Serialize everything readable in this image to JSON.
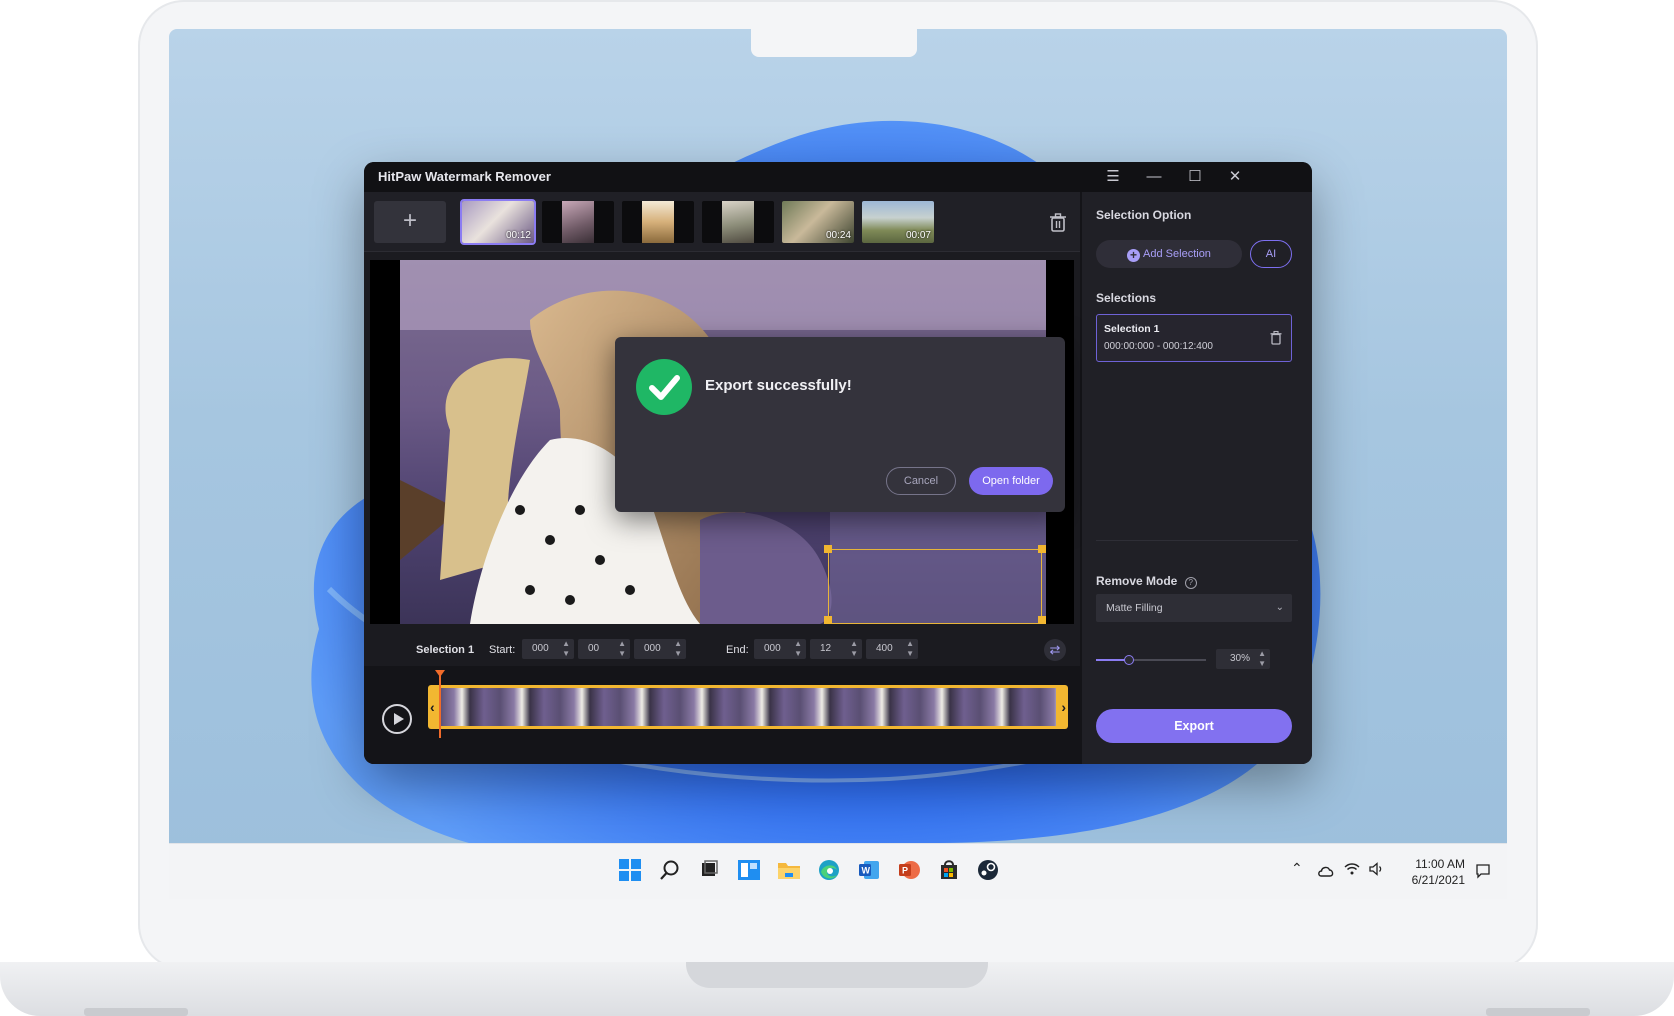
{
  "app": {
    "title": "HitPaw Watermark Remover"
  },
  "window_controls": {
    "menu_icon": "menu-icon",
    "minimize_icon": "minimize-icon",
    "maximize_icon": "maximize-icon",
    "close_icon": "close-icon"
  },
  "media_strip": {
    "add_label": "+",
    "thumbnails": [
      {
        "duration": "00:12",
        "active": true
      },
      {
        "duration": "",
        "active": false
      },
      {
        "duration": "",
        "active": false
      },
      {
        "duration": "",
        "active": false
      },
      {
        "duration": "00:24",
        "active": false
      },
      {
        "duration": "00:07",
        "active": false
      }
    ]
  },
  "dialog": {
    "message": "Export successfully!",
    "cancel_label": "Cancel",
    "open_folder_label": "Open folder"
  },
  "time_controls": {
    "selection_label": "Selection 1",
    "start_label": "Start:",
    "start": {
      "a": "000",
      "b": "00",
      "c": "000"
    },
    "end_label": "End:",
    "end": {
      "a": "000",
      "b": "12",
      "c": "400"
    }
  },
  "right_panel": {
    "selection_option_heading": "Selection Option",
    "add_selection_label": "Add Selection",
    "ai_label": "AI",
    "selections_heading": "Selections",
    "selections": [
      {
        "name": "Selection 1",
        "range": "000:00:000 - 000:12:400"
      }
    ],
    "remove_mode_heading": "Remove Mode",
    "remove_mode_value": "Matte Filling",
    "strength_percent": "30%",
    "strength_fraction": 0.3,
    "export_label": "Export"
  },
  "system": {
    "time": "11:00 AM",
    "date": "6/21/2021"
  },
  "colors": {
    "accent": "#8271f0",
    "success": "#1fb765",
    "selection_outline": "#f2b731"
  }
}
